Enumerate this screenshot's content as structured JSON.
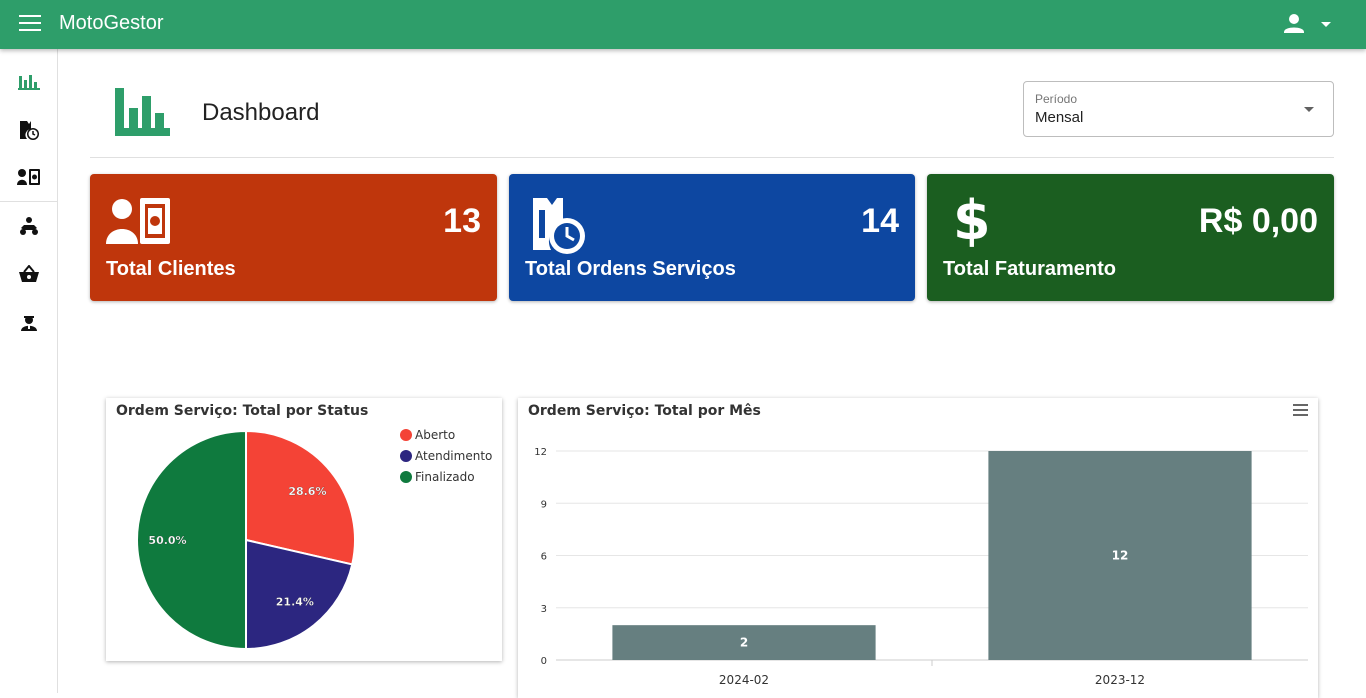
{
  "app": {
    "title": "MotoGestor"
  },
  "header": {
    "title": "Dashboard"
  },
  "periodo": {
    "label": "Período",
    "value": "Mensal"
  },
  "cards": [
    {
      "label": "Total Clientes",
      "value": "13",
      "color": "#bf360c",
      "icon": "client-card-icon"
    },
    {
      "label": "Total Ordens Serviços",
      "value": "14",
      "color": "#0d47a1",
      "icon": "service-order-clock-icon"
    },
    {
      "label": "Total Faturamento",
      "value": "R$ 0,00",
      "color": "#1b5e20",
      "icon": "dollar-icon"
    }
  ],
  "colors": {
    "brand": "#2e9e6a",
    "aberto": "#f44336",
    "atendimento": "#2c2680",
    "finalizado": "#0f7a3e",
    "bar": "#667f80"
  },
  "sidebar": {
    "icons": [
      "bar-chart-icon",
      "service-order-icon",
      "client-card-icon",
      "moto-icon",
      "basket-icon",
      "mechanic-icon"
    ]
  },
  "chart_data": [
    {
      "type": "pie",
      "title": "Ordem Serviço: Total por Status",
      "categories": [
        "Aberto",
        "Atendimento",
        "Finalizado"
      ],
      "values": [
        28.6,
        21.4,
        50.0
      ],
      "labels": [
        "28.6%",
        "21.4%",
        "50.0%"
      ],
      "legend": "top-right"
    },
    {
      "type": "bar",
      "title": "Ordem Serviço: Total por Mês",
      "categories": [
        "2024-02",
        "2023-12"
      ],
      "values": [
        2,
        12
      ],
      "ylim": [
        0,
        12
      ],
      "yticks": [
        0,
        3,
        6,
        9,
        12
      ],
      "grid": true
    }
  ]
}
